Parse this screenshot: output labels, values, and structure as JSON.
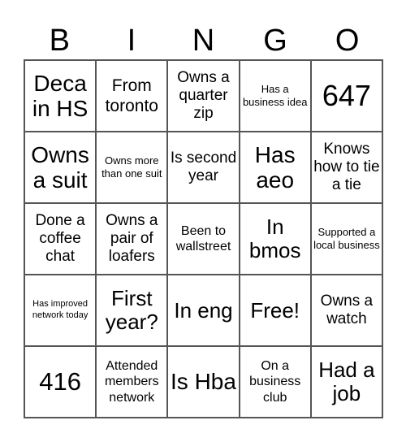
{
  "header": [
    "B",
    "I",
    "N",
    "G",
    "O"
  ],
  "cells": [
    [
      "Deca in HS",
      "From toronto",
      "Owns a quarter zip",
      "Has a business idea",
      "647"
    ],
    [
      "Owns a suit",
      "Owns more than one suit",
      "Is second year",
      "Has aeo",
      "Knows how to tie a tie"
    ],
    [
      "Done a coffee chat",
      "Owns a pair of loafers",
      "Been to wallstreet",
      "In bmos",
      "Supported a local business"
    ],
    [
      "Has improved network today",
      "First year?",
      "In eng",
      "Free!",
      "Owns a watch"
    ],
    [
      "416",
      "Attended members network",
      "Is Hba",
      "On a business club",
      "Had a job"
    ]
  ]
}
